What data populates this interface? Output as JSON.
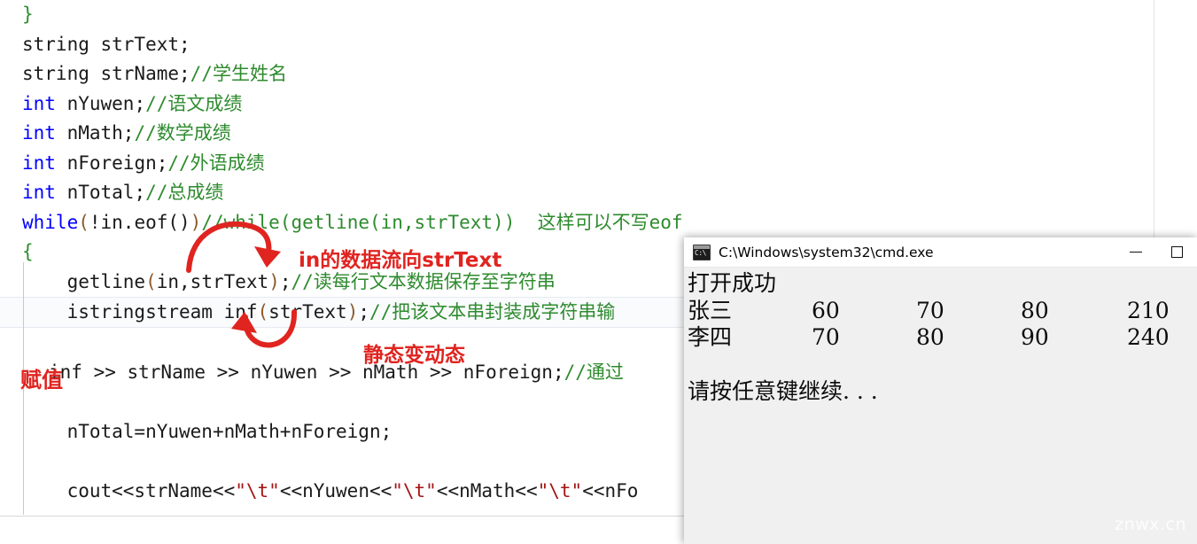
{
  "editor": {
    "name": "cpp-code-editor",
    "language": "C++",
    "lines": [
      {
        "id": "l1",
        "indent": 0,
        "tokens": [
          {
            "t": "}",
            "c": "brace"
          }
        ]
      },
      {
        "id": "l2",
        "indent": 0,
        "tokens": [
          {
            "t": "string strText;",
            "c": "plain"
          }
        ]
      },
      {
        "id": "l3",
        "indent": 0,
        "tokens": [
          {
            "t": "string strName;",
            "c": "plain"
          },
          {
            "t": "//学生姓名",
            "c": "cmt"
          }
        ]
      },
      {
        "id": "l4",
        "indent": 0,
        "tokens": [
          {
            "t": "int",
            "c": "kw2"
          },
          {
            "t": " nYuwen;",
            "c": "plain"
          },
          {
            "t": "//语文成绩",
            "c": "cmt"
          }
        ]
      },
      {
        "id": "l5",
        "indent": 0,
        "tokens": [
          {
            "t": "int",
            "c": "kw2"
          },
          {
            "t": " nMath;",
            "c": "plain"
          },
          {
            "t": "//数学成绩",
            "c": "cmt"
          }
        ]
      },
      {
        "id": "l6",
        "indent": 0,
        "tokens": [
          {
            "t": "int",
            "c": "kw2"
          },
          {
            "t": " nForeign;",
            "c": "plain"
          },
          {
            "t": "//外语成绩",
            "c": "cmt"
          }
        ]
      },
      {
        "id": "l7",
        "indent": 0,
        "tokens": [
          {
            "t": "int",
            "c": "kw2"
          },
          {
            "t": " nTotal;",
            "c": "plain"
          },
          {
            "t": "//总成绩",
            "c": "cmt"
          }
        ]
      },
      {
        "id": "l8",
        "indent": 0,
        "tokens": [
          {
            "t": "while",
            "c": "kw2"
          },
          {
            "t": "(",
            "c": "punc"
          },
          {
            "t": "!in.eof()",
            "c": "plain"
          },
          {
            "t": ")",
            "c": "punc"
          },
          {
            "t": "//while(getline(in,strText))  这样可以不写eof",
            "c": "cmt"
          }
        ]
      },
      {
        "id": "l9",
        "indent": 0,
        "tokens": [
          {
            "t": "{",
            "c": "brace"
          }
        ]
      },
      {
        "id": "l10",
        "indent": 1,
        "tokens": [
          {
            "t": "getline",
            "c": "plain"
          },
          {
            "t": "(",
            "c": "punc"
          },
          {
            "t": "in,strText",
            "c": "plain"
          },
          {
            "t": ")",
            "c": "punc"
          },
          {
            "t": ";",
            "c": "plain"
          },
          {
            "t": "//读每行文本数据保存至字符串",
            "c": "cmt"
          }
        ]
      },
      {
        "id": "l11",
        "indent": 1,
        "highlight": true,
        "tokens": [
          {
            "t": "istringstream inf",
            "c": "plain"
          },
          {
            "t": "(",
            "c": "punc"
          },
          {
            "t": "strText",
            "c": "plain"
          },
          {
            "t": ")",
            "c": "punc"
          },
          {
            "t": ";",
            "c": "plain"
          },
          {
            "t": "//把该文本串封装成字符串输",
            "c": "cmt"
          }
        ]
      },
      {
        "id": "l12",
        "indent": 0,
        "tokens": [
          {
            "t": "",
            "c": "plain"
          }
        ]
      },
      {
        "id": "l13",
        "indent": 0,
        "tokens": [
          {
            "t": "inf >> strName >> nYuwen >> nMath >> nForeign;",
            "c": "plain"
          },
          {
            "t": "//通过",
            "c": "cmt"
          }
        ],
        "leading_pad": 55
      },
      {
        "id": "l14",
        "indent": 0,
        "tokens": [
          {
            "t": "",
            "c": "plain"
          }
        ]
      },
      {
        "id": "l15",
        "indent": 1,
        "tokens": [
          {
            "t": "nTotal=nYuwen+nMath+nForeign;",
            "c": "plain"
          }
        ]
      },
      {
        "id": "l16",
        "indent": 0,
        "tokens": [
          {
            "t": "",
            "c": "plain"
          }
        ]
      },
      {
        "id": "l17",
        "indent": 1,
        "tokens": [
          {
            "t": "cout<<strName<<",
            "c": "plain"
          },
          {
            "t": "\"\\t\"",
            "c": "str"
          },
          {
            "t": "<<nYuwen<<",
            "c": "plain"
          },
          {
            "t": "\"\\t\"",
            "c": "str"
          },
          {
            "t": "<<nMath<<",
            "c": "plain"
          },
          {
            "t": "\"\\t\"",
            "c": "str"
          },
          {
            "t": "<<nFo",
            "c": "plain"
          }
        ]
      }
    ]
  },
  "annotations": {
    "color": "#e02420",
    "flow_label": "in的数据流向strText",
    "static_label": "静态变动态",
    "assign_label": "赋值"
  },
  "console": {
    "title": "C:\\Windows\\system32\\cmd.exe",
    "icon_name": "cmd-icon",
    "icon_text": "C:\\",
    "minimize_label": "—",
    "maximize_label": "□",
    "output": {
      "status_line": "打开成功",
      "prompt_line": "请按任意键继续. . .",
      "rows": [
        {
          "name": "张三",
          "yuwen": "60",
          "math": "70",
          "foreign": "80",
          "total": "210"
        },
        {
          "name": "李四",
          "yuwen": "70",
          "math": "80",
          "foreign": "90",
          "total": "240"
        }
      ]
    }
  },
  "watermark": {
    "text": "znwx.cn"
  }
}
